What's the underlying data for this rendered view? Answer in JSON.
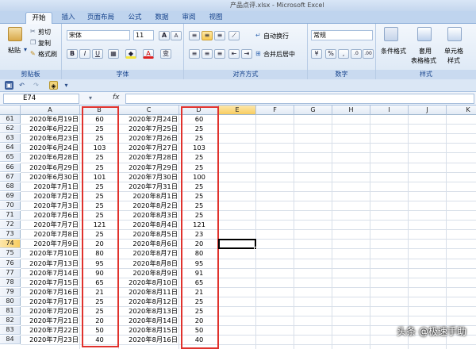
{
  "window": {
    "title": "产品点评.xlsx - Microsoft Excel",
    "faint_left": "",
    "faint_right": ""
  },
  "ribbon": {
    "tabs": [
      "开始",
      "插入",
      "页面布局",
      "公式",
      "数据",
      "审阅",
      "视图"
    ],
    "active_tab": "开始",
    "clipboard": {
      "paste": "粘贴",
      "cut": "剪切",
      "copy": "复制",
      "format_painter": "格式刷",
      "label": "剪贴板"
    },
    "font": {
      "name": "宋体",
      "size": "11",
      "grow": "A",
      "shrink": "A",
      "bold": "B",
      "italic": "I",
      "underline": "U",
      "color_glyph": "A",
      "wen": "变",
      "label": "字体"
    },
    "alignment": {
      "wrap": "自动换行",
      "merge": "合并后居中",
      "label": "对齐方式"
    },
    "number": {
      "format": "常规",
      "percent": "%",
      "comma": ",",
      "label": "数字"
    },
    "styles": {
      "conditional_line1": "条件格式",
      "table_line1": "套用",
      "table_line2": "表格格式",
      "cell_line1": "单元格",
      "cell_line2": "样式",
      "label": "样式"
    }
  },
  "formula_bar": {
    "name_box": "E74",
    "fx": "fx",
    "value": ""
  },
  "grid": {
    "columns": [
      "A",
      "B",
      "C",
      "D",
      "E",
      "F",
      "G",
      "H",
      "I",
      "J",
      "K"
    ],
    "selected_col": "E",
    "selected_row": 74,
    "rows": [
      {
        "n": 61,
        "a": "2020年6月19日",
        "b": "60",
        "c": "2020年7月24日",
        "d": "60"
      },
      {
        "n": 62,
        "a": "2020年6月22日",
        "b": "25",
        "c": "2020年7月25日",
        "d": "25"
      },
      {
        "n": 63,
        "a": "2020年6月23日",
        "b": "25",
        "c": "2020年7月26日",
        "d": "25"
      },
      {
        "n": 64,
        "a": "2020年6月24日",
        "b": "103",
        "c": "2020年7月27日",
        "d": "103"
      },
      {
        "n": 65,
        "a": "2020年6月28日",
        "b": "25",
        "c": "2020年7月28日",
        "d": "25"
      },
      {
        "n": 66,
        "a": "2020年6月29日",
        "b": "25",
        "c": "2020年7月29日",
        "d": "25"
      },
      {
        "n": 67,
        "a": "2020年6月30日",
        "b": "101",
        "c": "2020年7月30日",
        "d": "100"
      },
      {
        "n": 68,
        "a": "2020年7月1日",
        "b": "25",
        "c": "2020年7月31日",
        "d": "25"
      },
      {
        "n": 69,
        "a": "2020年7月2日",
        "b": "25",
        "c": "2020年8月1日",
        "d": "25"
      },
      {
        "n": 70,
        "a": "2020年7月3日",
        "b": "25",
        "c": "2020年8月2日",
        "d": "25"
      },
      {
        "n": 71,
        "a": "2020年7月6日",
        "b": "25",
        "c": "2020年8月3日",
        "d": "25"
      },
      {
        "n": 72,
        "a": "2020年7月7日",
        "b": "121",
        "c": "2020年8月4日",
        "d": "121"
      },
      {
        "n": 73,
        "a": "2020年7月8日",
        "b": "25",
        "c": "2020年8月5日",
        "d": "23"
      },
      {
        "n": 74,
        "a": "2020年7月9日",
        "b": "20",
        "c": "2020年8月6日",
        "d": "20"
      },
      {
        "n": 75,
        "a": "2020年7月10日",
        "b": "80",
        "c": "2020年8月7日",
        "d": "80"
      },
      {
        "n": 76,
        "a": "2020年7月13日",
        "b": "95",
        "c": "2020年8月8日",
        "d": "95"
      },
      {
        "n": 77,
        "a": "2020年7月14日",
        "b": "90",
        "c": "2020年8月9日",
        "d": "91"
      },
      {
        "n": 78,
        "a": "2020年7月15日",
        "b": "65",
        "c": "2020年8月10日",
        "d": "65"
      },
      {
        "n": 79,
        "a": "2020年7月16日",
        "b": "21",
        "c": "2020年8月11日",
        "d": "21"
      },
      {
        "n": 80,
        "a": "2020年7月17日",
        "b": "25",
        "c": "2020年8月12日",
        "d": "25"
      },
      {
        "n": 81,
        "a": "2020年7月20日",
        "b": "25",
        "c": "2020年8月13日",
        "d": "25"
      },
      {
        "n": 82,
        "a": "2020年7月21日",
        "b": "20",
        "c": "2020年8月14日",
        "d": "20"
      },
      {
        "n": 83,
        "a": "2020年7月22日",
        "b": "50",
        "c": "2020年8月15日",
        "d": "50"
      },
      {
        "n": 84,
        "a": "2020年7月23日",
        "b": "40",
        "c": "2020年8月16日",
        "d": "40"
      }
    ]
  },
  "colors": {
    "highlight_border": "#e0322d",
    "selected_header": "#f8cd60"
  },
  "watermark": "头条 @极速手助"
}
